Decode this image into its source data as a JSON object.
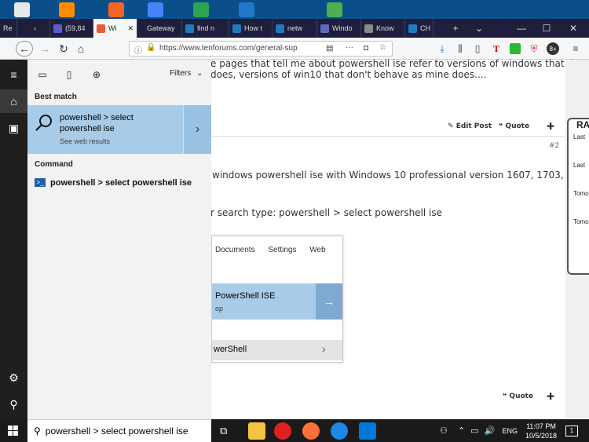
{
  "desktop": {
    "icon_colors": [
      "#e8e8e8",
      "#ff8c00",
      "#f26522",
      "#4285f4",
      "#2ea44f",
      "#1f78c8",
      "#4caf50"
    ]
  },
  "browser": {
    "tabs": [
      {
        "label": "Re",
        "color": "#888888",
        "active": false
      },
      {
        "label": "(59,84",
        "color": "#5b5bd6",
        "active": false
      },
      {
        "label": "Wi",
        "color": "#e85d3a",
        "active": true
      },
      {
        "label": "Gateway",
        "color": "#1f1f3d",
        "active": false
      },
      {
        "label": "find n",
        "color": "#1d7bc0",
        "active": false
      },
      {
        "label": "How t",
        "color": "#1d7bc0",
        "active": false
      },
      {
        "label": "netw",
        "color": "#1d7bc0",
        "active": false
      },
      {
        "label": "Windo",
        "color": "#5c6bc0",
        "active": false
      },
      {
        "label": "Know",
        "color": "#888888",
        "active": false
      },
      {
        "label": "CH",
        "color": "#1d7bc0",
        "active": false
      }
    ],
    "new_tab_icon": "+",
    "tab_list_icon": "chevron-down",
    "window_buttons": {
      "minimize": "—",
      "maximize": "☐",
      "close": "✕"
    },
    "url": "https://www.tenforums.com/general-sup",
    "toolbar_badge": "8+"
  },
  "page": {
    "line1": "e pages that tell me about powershell ise refer to versions of windows that don't",
    "line2": "does, versions of win10 that don't behave as mine does....",
    "edit_post": "Edit Post",
    "quote": "Quote",
    "post_number": "#2",
    "line3": "windows powershell ise with Windows 10 professional version 1607, 1703, 1709,",
    "line4": "r search type: powershell > select powershell ise",
    "embedded": {
      "tabs": [
        "Documents",
        "Settings",
        "Web"
      ],
      "best_title_bold": "PowerShell ISE",
      "best_sub": "op",
      "item": "werShell"
    },
    "quote2": "Quote",
    "side": {
      "heading": "RA",
      "items": [
        "Last",
        "Last",
        "Tomo",
        "Tomo"
      ]
    }
  },
  "start_menu": {
    "filters_label": "Filters",
    "best_match_header": "Best match",
    "best_match": {
      "title_line1": "powershell > select",
      "title_line2": "powershell ise",
      "subtitle": "See web results"
    },
    "command_header": "Command",
    "command_item": "powershell > select powershell ise",
    "search_value": "powershell > select powershell ise"
  },
  "taskbar": {
    "time": "11:07 PM",
    "date": "10/5/2018",
    "language": "ENG",
    "notification_count": "1",
    "app_colors": [
      "#f5c242",
      "#e02020",
      "#ff7139",
      "#1e88e5",
      "#0078d7"
    ]
  }
}
